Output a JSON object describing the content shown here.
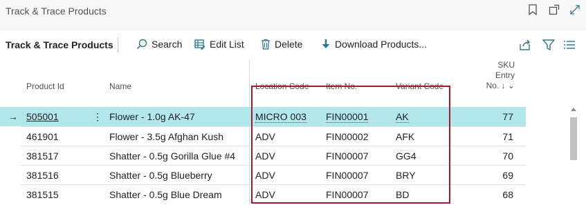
{
  "window": {
    "title": "Track & Trace Products"
  },
  "toolbar": {
    "page_name": "Track & Trace Products",
    "search_label": "Search",
    "edit_list_label": "Edit List",
    "delete_label": "Delete",
    "download_label": "Download Products..."
  },
  "columns": {
    "product_id": "Product Id",
    "name": "Name",
    "location_code": "Location Code",
    "item_no": "Item No.",
    "variant_code": "Variant Code",
    "sku_entry_line1": "SKU Entry",
    "sku_entry_line2": "No. ↓ ⌄"
  },
  "rows": [
    {
      "product_id": "505001",
      "name": "Flower - 1.0g AK-47",
      "location_code": "MICRO 003",
      "item_no": "FIN00001",
      "variant_code": "AK",
      "sku_entry_no": "77"
    },
    {
      "product_id": "461901",
      "name": "Flower - 3.5g Afghan Kush",
      "location_code": "ADV",
      "item_no": "FIN00002",
      "variant_code": "AFK",
      "sku_entry_no": "71"
    },
    {
      "product_id": "381517",
      "name": "Shatter - 0.5g Gorilla Glue #4",
      "location_code": "ADV",
      "item_no": "FIN00007",
      "variant_code": "GG4",
      "sku_entry_no": "70"
    },
    {
      "product_id": "381516",
      "name": "Shatter - 0.5g Blueberry",
      "location_code": "ADV",
      "item_no": "FIN00007",
      "variant_code": "BRY",
      "sku_entry_no": "69"
    },
    {
      "product_id": "381515",
      "name": "Shatter - 0.5g Blue Dream",
      "location_code": "ADV",
      "item_no": "FIN00007",
      "variant_code": "BD",
      "sku_entry_no": "68"
    }
  ],
  "selected_row_arrow": "→",
  "row_menu_glyph": "⋮",
  "colors": {
    "accent": "#2c7a8c",
    "selected_row": "#b2e8ec",
    "highlight_border": "#a8182a"
  }
}
